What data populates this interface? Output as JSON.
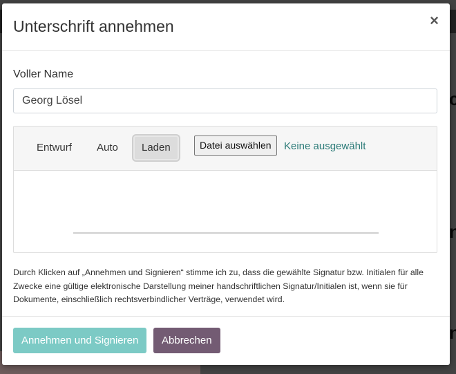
{
  "dialog": {
    "title": "Unterschrift annehmen",
    "close_label": "×"
  },
  "name_field": {
    "label": "Voller Name",
    "value": "Georg Lösel"
  },
  "signature": {
    "tabs": [
      {
        "label": "Entwurf",
        "active": false
      },
      {
        "label": "Auto",
        "active": false
      },
      {
        "label": "Laden",
        "active": true
      }
    ],
    "file_button_label": "Datei auswählen",
    "file_status": "Keine ausgewählt"
  },
  "disclaimer": "Durch Klicken auf „Annehmen und Signieren“ stimme ich zu, dass die gewählte Signatur bzw. Initialen für alle Zwecke eine gültige elektronische Darstellung meiner handschriftlichen Signatur/Initialen ist, wenn sie für Dokumente, einschließlich rechtsverbindlicher Verträge, verwendet wird.",
  "footer": {
    "accept_label": "Annehmen und Signieren",
    "cancel_label": "Abbrechen"
  },
  "colors": {
    "accept_button": "#7ccac5",
    "cancel_button": "#735b73",
    "file_status_text": "#2c7b78"
  }
}
